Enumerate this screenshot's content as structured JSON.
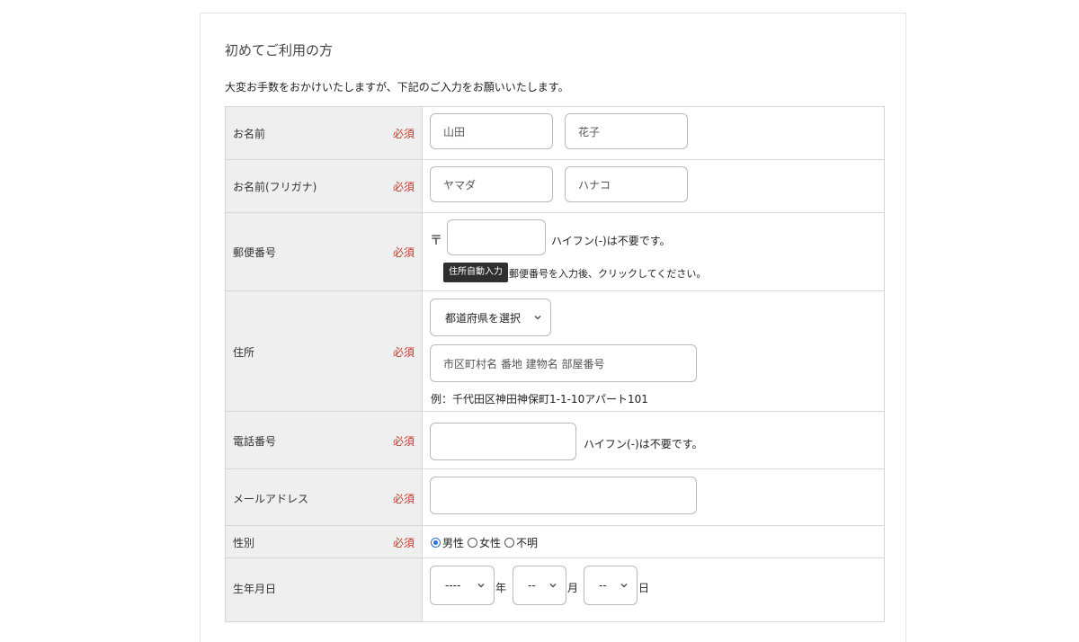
{
  "section": {
    "heading": "初めてご利用の方",
    "intro": "大変お手数をおかけいたしますが、下記のご入力をお願いいたします。"
  },
  "required_label": "必須",
  "fields": {
    "name": {
      "label": "お名前",
      "last_placeholder": "山田",
      "first_placeholder": "花子"
    },
    "kana": {
      "label": "お名前(フリガナ)",
      "last_placeholder": "ヤマダ",
      "first_placeholder": "ハナコ"
    },
    "postal": {
      "label": "郵便番号",
      "symbol": "〒",
      "value": "",
      "note": "ハイフン(-)は不要です。",
      "auto_button": "住所自動入力",
      "auto_note": "郵便番号を入力後、クリックしてください。"
    },
    "address": {
      "label": "住所",
      "prefecture_selected": "都道府県を選択",
      "detail_placeholder": "市区町村名 番地 建物名 部屋番号",
      "example": "例：千代田区神田神保町1-1-10アパート101"
    },
    "phone": {
      "label": "電話番号",
      "value": "",
      "note": "ハイフン(-)は不要です。"
    },
    "email": {
      "label": "メールアドレス",
      "value": ""
    },
    "gender": {
      "label": "性別",
      "options": [
        "男性",
        "女性",
        "不明"
      ],
      "selected": "男性"
    },
    "birthday": {
      "label": "生年月日",
      "year_selected": "----",
      "year_unit": "年",
      "month_selected": "--",
      "month_unit": "月",
      "day_selected": "--",
      "day_unit": "日"
    }
  }
}
